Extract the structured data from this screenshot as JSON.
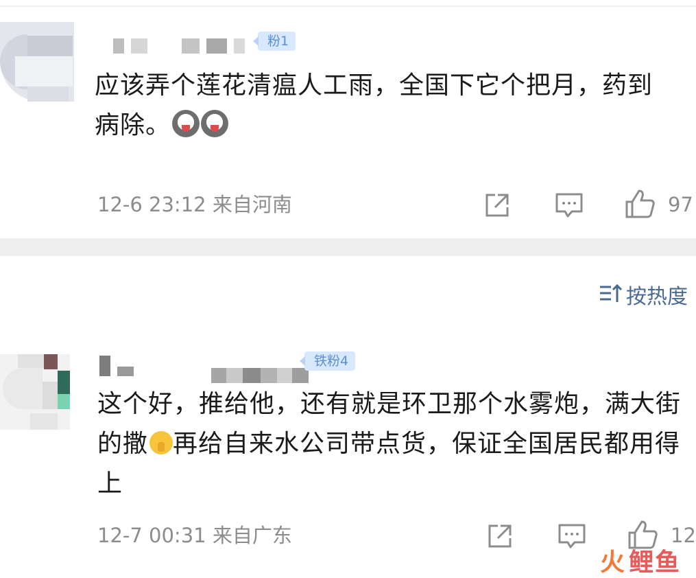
{
  "comments": [
    {
      "badge": "粉1",
      "text": "应该弄个莲花清瘟人工雨，全国下它个把月，药到病除。",
      "time": "12-6 23:12",
      "location": "来自河南",
      "likes": "97"
    },
    {
      "badge": "铁粉4",
      "text_part1": "这个好，推给他，还有就是环卫那个水雾炮，满大街的撒",
      "text_part2": "再给自来水公司带点货，保证全国居民都用得上",
      "time": "12-7 00:31",
      "location": "来自广东",
      "likes": "12"
    }
  ],
  "sort": {
    "label": "按热度"
  },
  "watermark": {
    "fire": "火",
    "rest": "鲤鱼"
  },
  "icons": {
    "share": "share-icon",
    "reply": "comment-icon",
    "like": "thumbs-up-icon",
    "sort": "sort-icon"
  },
  "colors": {
    "meta_text": "#8c8c8c",
    "badge_bg": "#d8e8ff",
    "badge_text": "#5b8fd4",
    "sort_text": "#4a6a92",
    "divider": "#eeeeee"
  }
}
